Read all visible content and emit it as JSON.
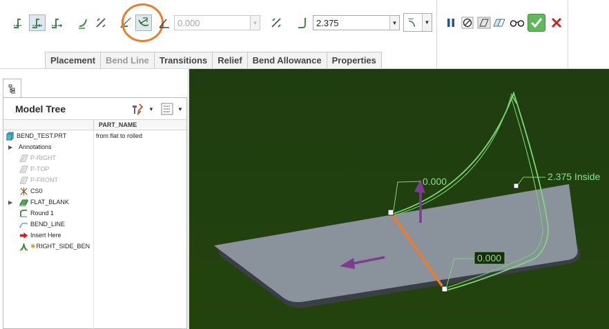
{
  "toolbar": {
    "radius_value": "0.000",
    "dimension_value": "2.375",
    "tabs": [
      {
        "label": "Placement",
        "enabled": true
      },
      {
        "label": "Bend Line",
        "enabled": false
      },
      {
        "label": "Transitions",
        "enabled": true
      },
      {
        "label": "Relief",
        "enabled": true
      },
      {
        "label": "Bend Allowance",
        "enabled": true
      },
      {
        "label": "Properties",
        "enabled": true
      }
    ],
    "highlight_color": "#f07a2a"
  },
  "model_tree": {
    "title": "Model Tree",
    "column_header": "PART_NAME",
    "items": [
      {
        "label": "BEND_TEST.PRT",
        "icon": "part-icon",
        "part_name": "from flat to rolled",
        "suppressed": false
      },
      {
        "label": "Annotations",
        "icon": "none",
        "suppressed": false
      },
      {
        "label": "P-RIGHT",
        "icon": "datum-plane-icon",
        "suppressed": true
      },
      {
        "label": "P-TOP",
        "icon": "datum-plane-icon",
        "suppressed": true
      },
      {
        "label": "P-FRONT",
        "icon": "datum-plane-icon",
        "suppressed": true
      },
      {
        "label": "CS0",
        "icon": "coordinate-system-icon",
        "suppressed": false
      },
      {
        "label": "FLAT_BLANK",
        "icon": "flat-wall-icon",
        "suppressed": false
      },
      {
        "label": "Round 1",
        "icon": "round-icon",
        "suppressed": false
      },
      {
        "label": "BEND_LINE",
        "icon": "sketch-icon",
        "suppressed": false
      },
      {
        "label": "Insert Here",
        "icon": "insert-arrow-icon",
        "suppressed": false
      },
      {
        "label": "RIGHT_SIDE_BEN",
        "icon": "bend-feature-icon",
        "suppressed": false
      }
    ]
  },
  "viewport": {
    "background_color": "#21400f",
    "plate_color": "#8a939c",
    "bend_line_color": "#f07a2a",
    "bend_curve_color": "#7fd67a",
    "arrow_color": "#7a3d8f",
    "dim_label_top": "0.000",
    "dim_label_bottom": "0.000",
    "dim_label_right": "2.375 Inside"
  }
}
